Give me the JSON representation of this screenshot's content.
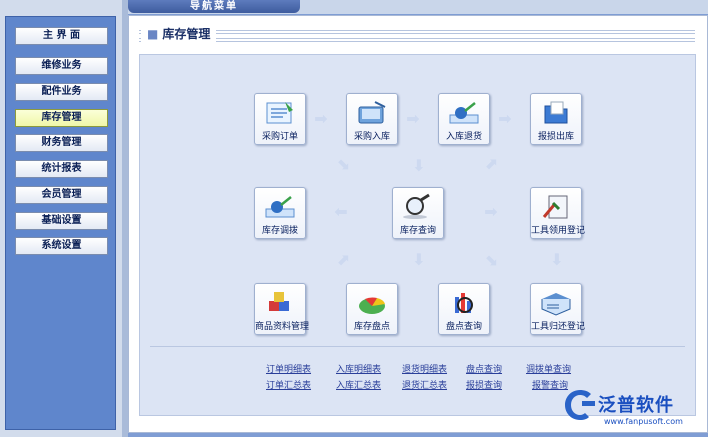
{
  "nav_menu": {
    "title": "导航菜单",
    "items": [
      {
        "label": "主 界 面",
        "active": false
      },
      {
        "label": "维修业务",
        "active": false
      },
      {
        "label": "配件业务",
        "active": false
      },
      {
        "label": "库存管理",
        "active": true
      },
      {
        "label": "财务管理",
        "active": false
      },
      {
        "label": "统计报表",
        "active": false
      },
      {
        "label": "会员管理",
        "active": false
      },
      {
        "label": "基础设置",
        "active": false
      },
      {
        "label": "系统设置",
        "active": false
      }
    ]
  },
  "section": {
    "title": "库存管理"
  },
  "tiles": [
    {
      "label": "采购订单",
      "icon": "purchase-order-icon"
    },
    {
      "label": "采购入库",
      "icon": "purchase-receipt-icon"
    },
    {
      "label": "入库退货",
      "icon": "receipt-return-icon"
    },
    {
      "label": "报损出库",
      "icon": "loss-outbound-icon"
    },
    {
      "label": "库存调拨",
      "icon": "stock-transfer-icon"
    },
    {
      "label": "库存查询",
      "icon": "stock-query-icon"
    },
    {
      "label": "工具领用登记",
      "icon": "tool-checkout-icon"
    },
    {
      "label": "商品资料管理",
      "icon": "product-data-icon"
    },
    {
      "label": "库存盘点",
      "icon": "stock-take-icon"
    },
    {
      "label": "盘点查询",
      "icon": "stock-take-query-icon"
    },
    {
      "label": "工具归还登记",
      "icon": "tool-return-icon"
    }
  ],
  "reports": {
    "row1": [
      "订单明细表",
      "入库明细表",
      "退货明细表",
      "盘点查询",
      "调拨单查询"
    ],
    "row2": [
      "订单汇总表",
      "入库汇总表",
      "退货汇总表",
      "报损查询",
      "报警查询"
    ]
  },
  "logo": {
    "brand": "泛普软件",
    "url": "www.fanpusoft.com"
  },
  "colors": {
    "accent": "#5f86cc",
    "active_nav": "#f0f7a8",
    "link": "#2a3f9a"
  }
}
